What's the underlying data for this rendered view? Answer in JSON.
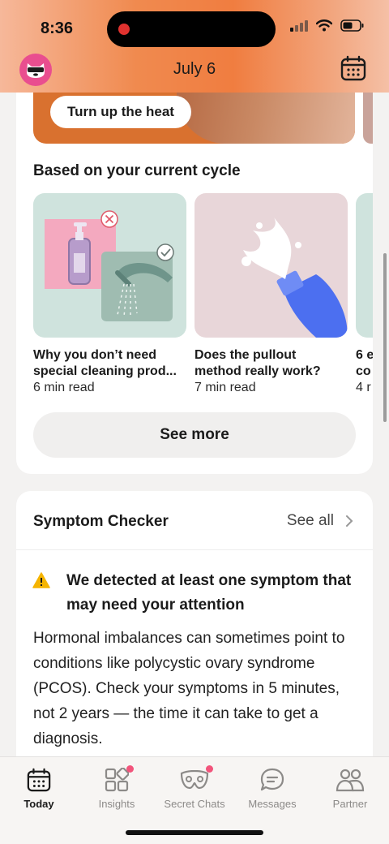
{
  "status": {
    "time": "8:36"
  },
  "header": {
    "date": "July 6"
  },
  "hero": {
    "button_label": "Turn up the heat"
  },
  "cycle": {
    "title": "Based on your current cycle",
    "articles": [
      {
        "title_line1": "Why you don’t need",
        "title_line2": "special cleaning prod...",
        "meta": "6 min read"
      },
      {
        "title_line1": "Does the pullout",
        "title_line2": "method really work?",
        "meta": "7 min read"
      },
      {
        "title_line1": "6 e",
        "title_line2": "co",
        "meta": "4 r"
      }
    ],
    "see_more": "See more"
  },
  "symptom_checker": {
    "title": "Symptom Checker",
    "see_all": "See all",
    "alert": "We detected at least one symptom that may need your attention",
    "body": "Hormonal imbalances can sometimes point to conditions like polycystic ovary syndrome (PCOS). Check your symptoms in 5 minutes, not 2 years — the time it can take to get a diagnosis."
  },
  "tabs": [
    {
      "label": "Today",
      "icon": "calendar-icon",
      "active": true
    },
    {
      "label": "Insights",
      "icon": "grid-icon",
      "badge": true
    },
    {
      "label": "Secret Chats",
      "icon": "mask-icon",
      "badge": true
    },
    {
      "label": "Messages",
      "icon": "chat-icon"
    },
    {
      "label": "Partner",
      "icon": "people-icon"
    }
  ],
  "colors": {
    "accent": "#f07d40",
    "brand_pink": "#e94e8f",
    "badge": "#f2547b",
    "warning": "#f5b400"
  }
}
